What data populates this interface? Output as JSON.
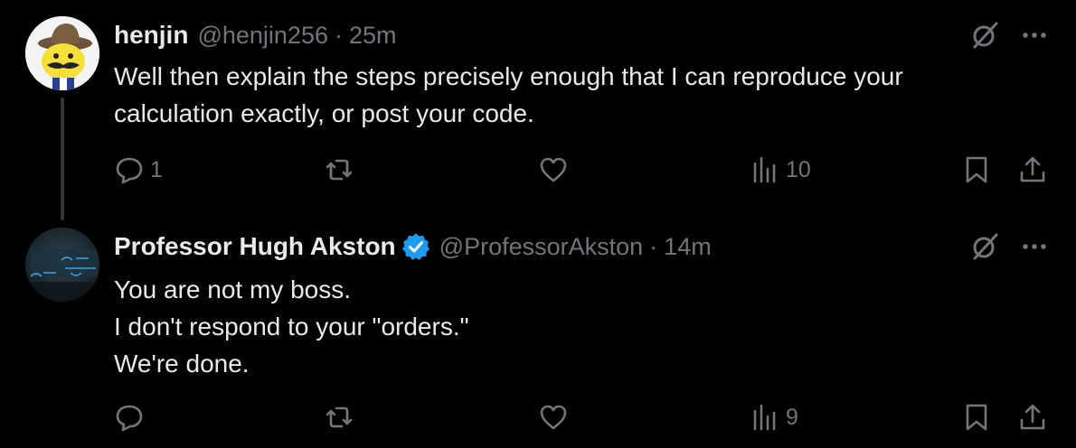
{
  "colors": {
    "background": "#000000",
    "primary_text": "#e7e9ea",
    "secondary_text": "#71767b",
    "icon": "#71767b",
    "verified": "#1d9bf0",
    "thread_line": "#333639"
  },
  "tweets": [
    {
      "display_name": "henjin",
      "handle": "@henjin256",
      "separator": "·",
      "time": "25m",
      "verified": false,
      "text_lines": [
        "Well then explain the steps precisely enough that I can reproduce your",
        "calculation exactly, or post your code."
      ],
      "actions": {
        "reply_count": "1",
        "retweet_count": "",
        "like_count": "",
        "views_count": "10"
      },
      "icons": {
        "avatar": "cartoon-character-avatar",
        "grok": "grok-slash-icon",
        "more": "more-dots-icon"
      }
    },
    {
      "display_name": "Professor Hugh Akston",
      "handle": "@ProfessorAkston",
      "separator": "·",
      "time": "14m",
      "verified": true,
      "text_lines": [
        "You are not my boss.",
        "I don't respond to your \"orders.\"",
        "We're done."
      ],
      "actions": {
        "reply_count": "",
        "retweet_count": "",
        "like_count": "",
        "views_count": "9"
      },
      "icons": {
        "avatar": "bayes-formula-avatar",
        "grok": "grok-slash-icon",
        "more": "more-dots-icon"
      }
    }
  ]
}
